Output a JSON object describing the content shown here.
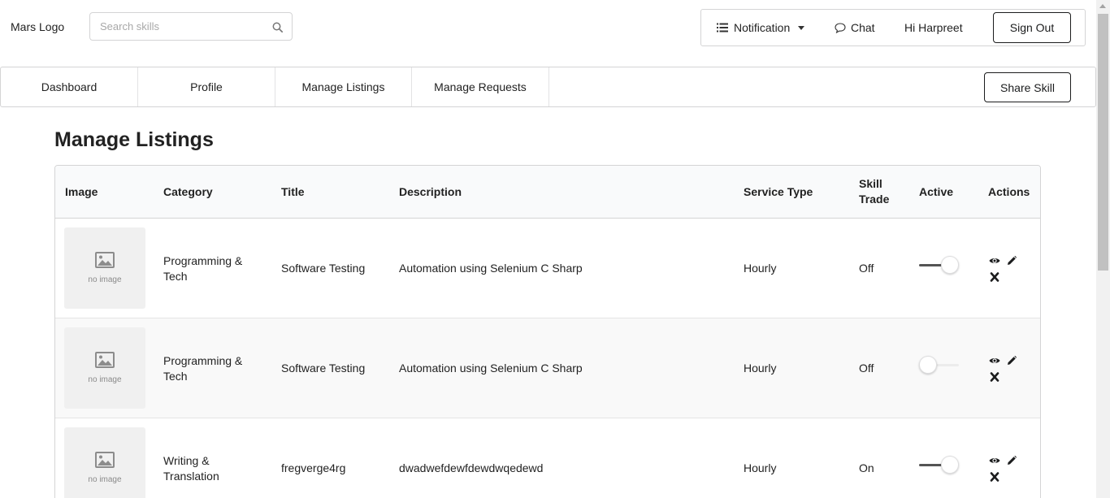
{
  "header": {
    "logo": "Mars Logo",
    "search": {
      "placeholder": "Search skills"
    },
    "notification_label": "Notification",
    "chat_label": "Chat",
    "greeting": "Hi Harpreet",
    "signout_label": "Sign Out"
  },
  "tabs": [
    {
      "label": "Dashboard"
    },
    {
      "label": "Profile"
    },
    {
      "label": "Manage Listings"
    },
    {
      "label": "Manage Requests"
    }
  ],
  "share_label": "Share Skill",
  "page_title": "Manage Listings",
  "table": {
    "headers": {
      "image": "Image",
      "category": "Category",
      "title": "Title",
      "description": "Description",
      "service_type": "Service Type",
      "skill_trade_1": "Skill",
      "skill_trade_2": "Trade",
      "active": "Active",
      "actions": "Actions"
    },
    "no_image_text": "no image",
    "rows": [
      {
        "category_1": "Programming &",
        "category_2": "Tech",
        "title": "Software Testing",
        "description": "Automation using Selenium C Sharp",
        "service_type": "Hourly",
        "skill_trade": "Off",
        "active": true
      },
      {
        "category_1": "Programming &",
        "category_2": "Tech",
        "title": "Software Testing",
        "description": "Automation using Selenium C Sharp",
        "service_type": "Hourly",
        "skill_trade": "Off",
        "active": false
      },
      {
        "category_1": "Writing &",
        "category_2": "Translation",
        "title": "fregverge4rg",
        "description": "dwadwefdewfdewdwqedewd",
        "service_type": "Hourly",
        "skill_trade": "On",
        "active": true
      }
    ]
  },
  "icons": {
    "search": "search-icon",
    "notification": "list-icon",
    "chat": "chat-bubble-icon",
    "view": "eye-icon",
    "edit": "pencil-icon",
    "delete": "close-icon",
    "image_placeholder": "image-icon"
  }
}
